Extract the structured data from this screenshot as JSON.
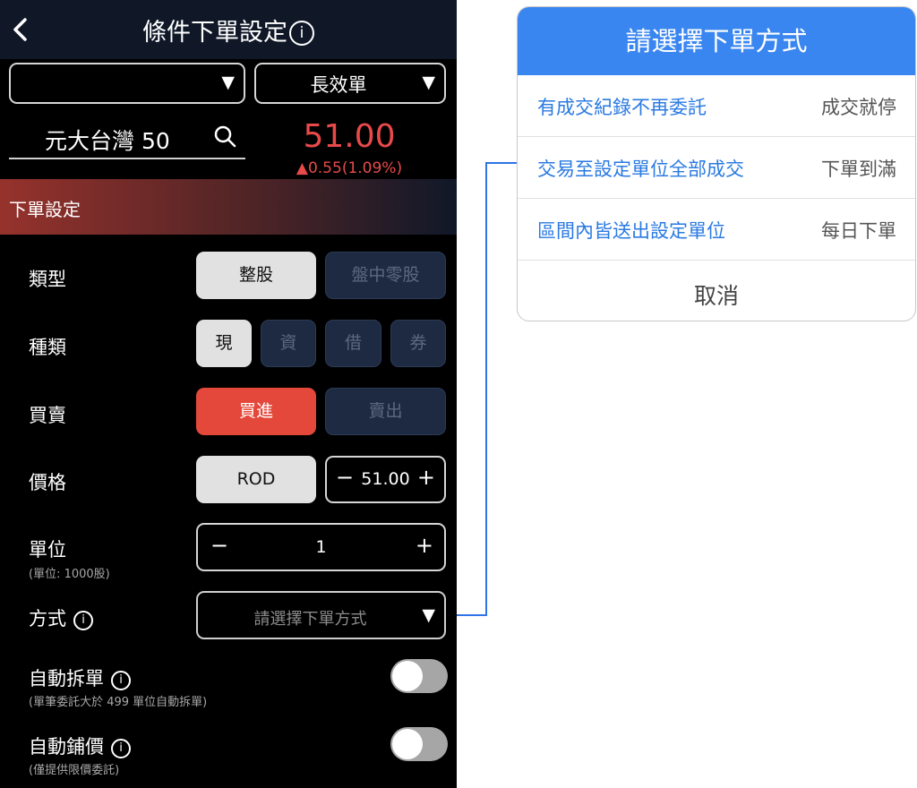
{
  "header": {
    "title": "條件下單設定",
    "info_icon": "i"
  },
  "top_dropdowns": {
    "left_value": "",
    "right_value": "長效單",
    "arrow": "▼"
  },
  "stock": {
    "name": "元大台灣 50",
    "price": "51.00",
    "change": "▲0.55(1.09%)"
  },
  "section_title": "下單設定",
  "rows": {
    "type": {
      "label": "類型",
      "options": [
        "整股",
        "盤中零股"
      ],
      "selected": "整股"
    },
    "kind": {
      "label": "種類",
      "options": [
        "現",
        "資",
        "借",
        "券"
      ],
      "selected": "現"
    },
    "side": {
      "label": "買賣",
      "options": [
        "買進",
        "賣出"
      ],
      "selected": "買進"
    },
    "price": {
      "label": "價格",
      "type_button": "ROD",
      "minus": "−",
      "value": "51.00",
      "plus": "+"
    },
    "unit": {
      "label": "單位",
      "sublabel": "(單位: 1000股)",
      "minus": "−",
      "value": "1",
      "plus": "+"
    },
    "method": {
      "label": "方式",
      "info_icon": "i",
      "placeholder": "請選擇下單方式",
      "arrow": "▼"
    },
    "auto_split": {
      "label": "自動拆單",
      "info_icon": "i",
      "sublabel": "(單筆委託大於 499 單位自動拆單)",
      "enabled": false
    },
    "auto_price": {
      "label": "自動鋪價",
      "info_icon": "i",
      "sublabel": "(僅提供限價委託)",
      "enabled": false
    }
  },
  "modal": {
    "title": "請選擇下單方式",
    "options": [
      {
        "label": "有成交紀錄不再委託",
        "tag": "成交就停"
      },
      {
        "label": "交易至設定單位全部成交",
        "tag": "下單到滿"
      },
      {
        "label": "區間內皆送出設定單位",
        "tag": "每日下單"
      }
    ],
    "cancel": "取消"
  },
  "colors": {
    "accent_blue": "#3a86f0",
    "buy_red": "#e3483a",
    "price_red": "#e84a4a",
    "connector": "#2f74e6"
  }
}
